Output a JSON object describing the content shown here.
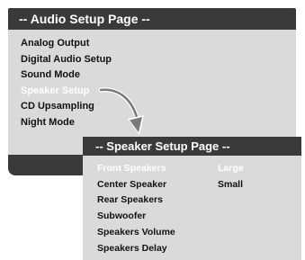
{
  "audio_setup": {
    "title": "-- Audio Setup Page --",
    "items": [
      {
        "label": "Analog Output",
        "selected": false
      },
      {
        "label": "Digital Audio Setup",
        "selected": false
      },
      {
        "label": "Sound Mode",
        "selected": false
      },
      {
        "label": "Speaker Setup",
        "selected": true
      },
      {
        "label": "CD Upsampling",
        "selected": false
      },
      {
        "label": "Night Mode",
        "selected": false
      }
    ]
  },
  "speaker_setup": {
    "title": "-- Speaker Setup Page --",
    "items": [
      {
        "label": "Front Speakers",
        "selected": true
      },
      {
        "label": "Center Speaker",
        "selected": false
      },
      {
        "label": "Rear Speakers",
        "selected": false
      },
      {
        "label": "Subwoofer",
        "selected": false
      },
      {
        "label": "Speakers Volume",
        "selected": false
      },
      {
        "label": "Speakers Delay",
        "selected": false
      }
    ],
    "options": [
      {
        "label": "Large",
        "selected": true
      },
      {
        "label": "Small",
        "selected": false
      }
    ]
  },
  "colors": {
    "header": "#3a3a3a",
    "body": "#dadada",
    "selected_text": "#ffffff",
    "text": "#111111"
  },
  "icons": {
    "arrow": "curved-arrow-icon"
  }
}
